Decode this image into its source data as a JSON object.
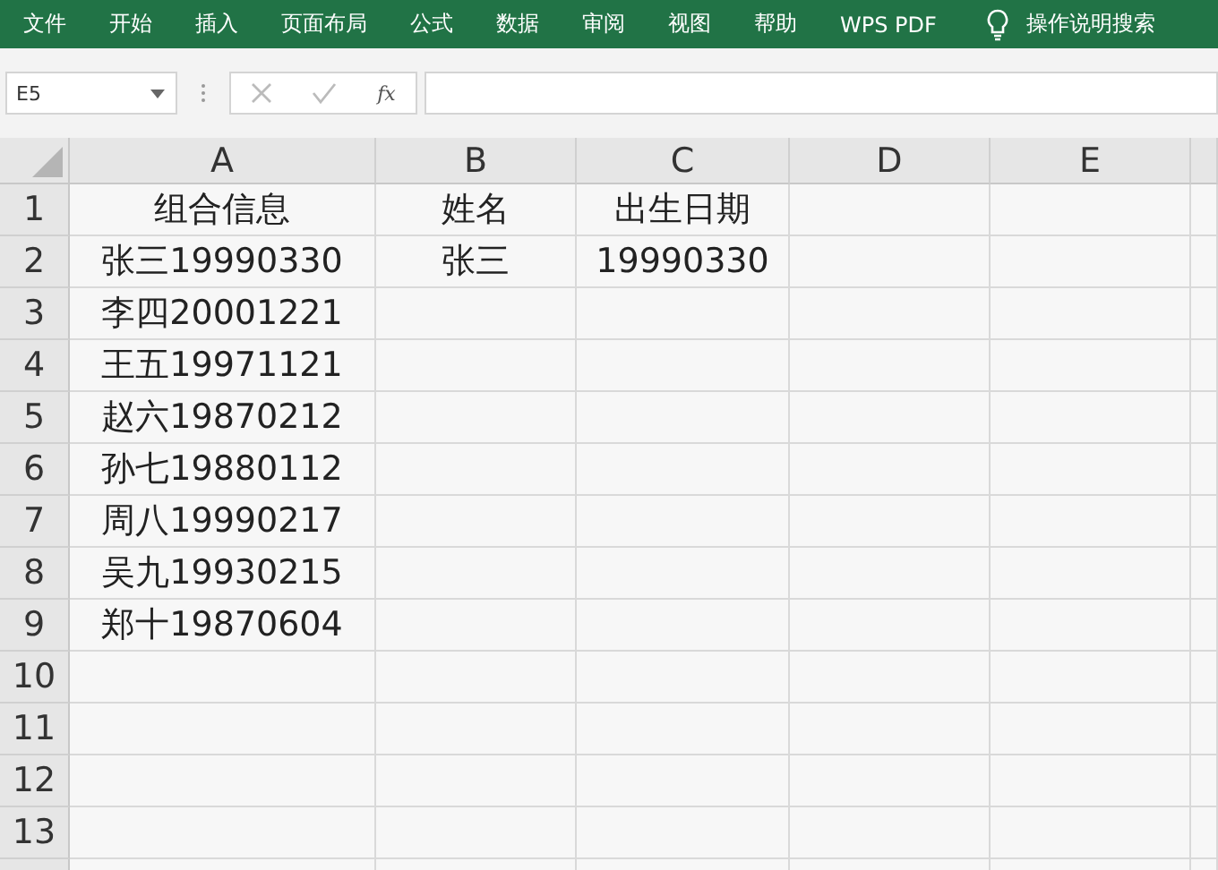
{
  "ribbon": {
    "tabs": [
      {
        "label": "文件"
      },
      {
        "label": "开始"
      },
      {
        "label": "插入"
      },
      {
        "label": "页面布局"
      },
      {
        "label": "公式"
      },
      {
        "label": "数据"
      },
      {
        "label": "审阅"
      },
      {
        "label": "视图"
      },
      {
        "label": "帮助"
      },
      {
        "label": "WPS PDF"
      }
    ],
    "search": "操作说明搜索"
  },
  "formula_bar": {
    "name_box": "E5",
    "fx": "fx"
  },
  "sheet": {
    "columns": [
      "A",
      "B",
      "C",
      "D",
      "E"
    ],
    "rows": [
      {
        "number": "1",
        "cells": [
          "组合信息",
          "姓名",
          "出生日期",
          "",
          ""
        ]
      },
      {
        "number": "2",
        "cells": [
          "张三19990330",
          "张三",
          "19990330",
          "",
          ""
        ]
      },
      {
        "number": "3",
        "cells": [
          "李四20001221",
          "",
          "",
          "",
          ""
        ]
      },
      {
        "number": "4",
        "cells": [
          "王五19971121",
          "",
          "",
          "",
          ""
        ]
      },
      {
        "number": "5",
        "cells": [
          "赵六19870212",
          "",
          "",
          "",
          ""
        ]
      },
      {
        "number": "6",
        "cells": [
          "孙七19880112",
          "",
          "",
          "",
          ""
        ]
      },
      {
        "number": "7",
        "cells": [
          "周八19990217",
          "",
          "",
          "",
          ""
        ]
      },
      {
        "number": "8",
        "cells": [
          "吴九19930215",
          "",
          "",
          "",
          ""
        ]
      },
      {
        "number": "9",
        "cells": [
          "郑十19870604",
          "",
          "",
          "",
          ""
        ]
      },
      {
        "number": "10",
        "cells": [
          "",
          "",
          "",
          "",
          ""
        ]
      },
      {
        "number": "11",
        "cells": [
          "",
          "",
          "",
          "",
          ""
        ]
      },
      {
        "number": "12",
        "cells": [
          "",
          "",
          "",
          "",
          ""
        ]
      },
      {
        "number": "13",
        "cells": [
          "",
          "",
          "",
          "",
          ""
        ]
      }
    ]
  }
}
